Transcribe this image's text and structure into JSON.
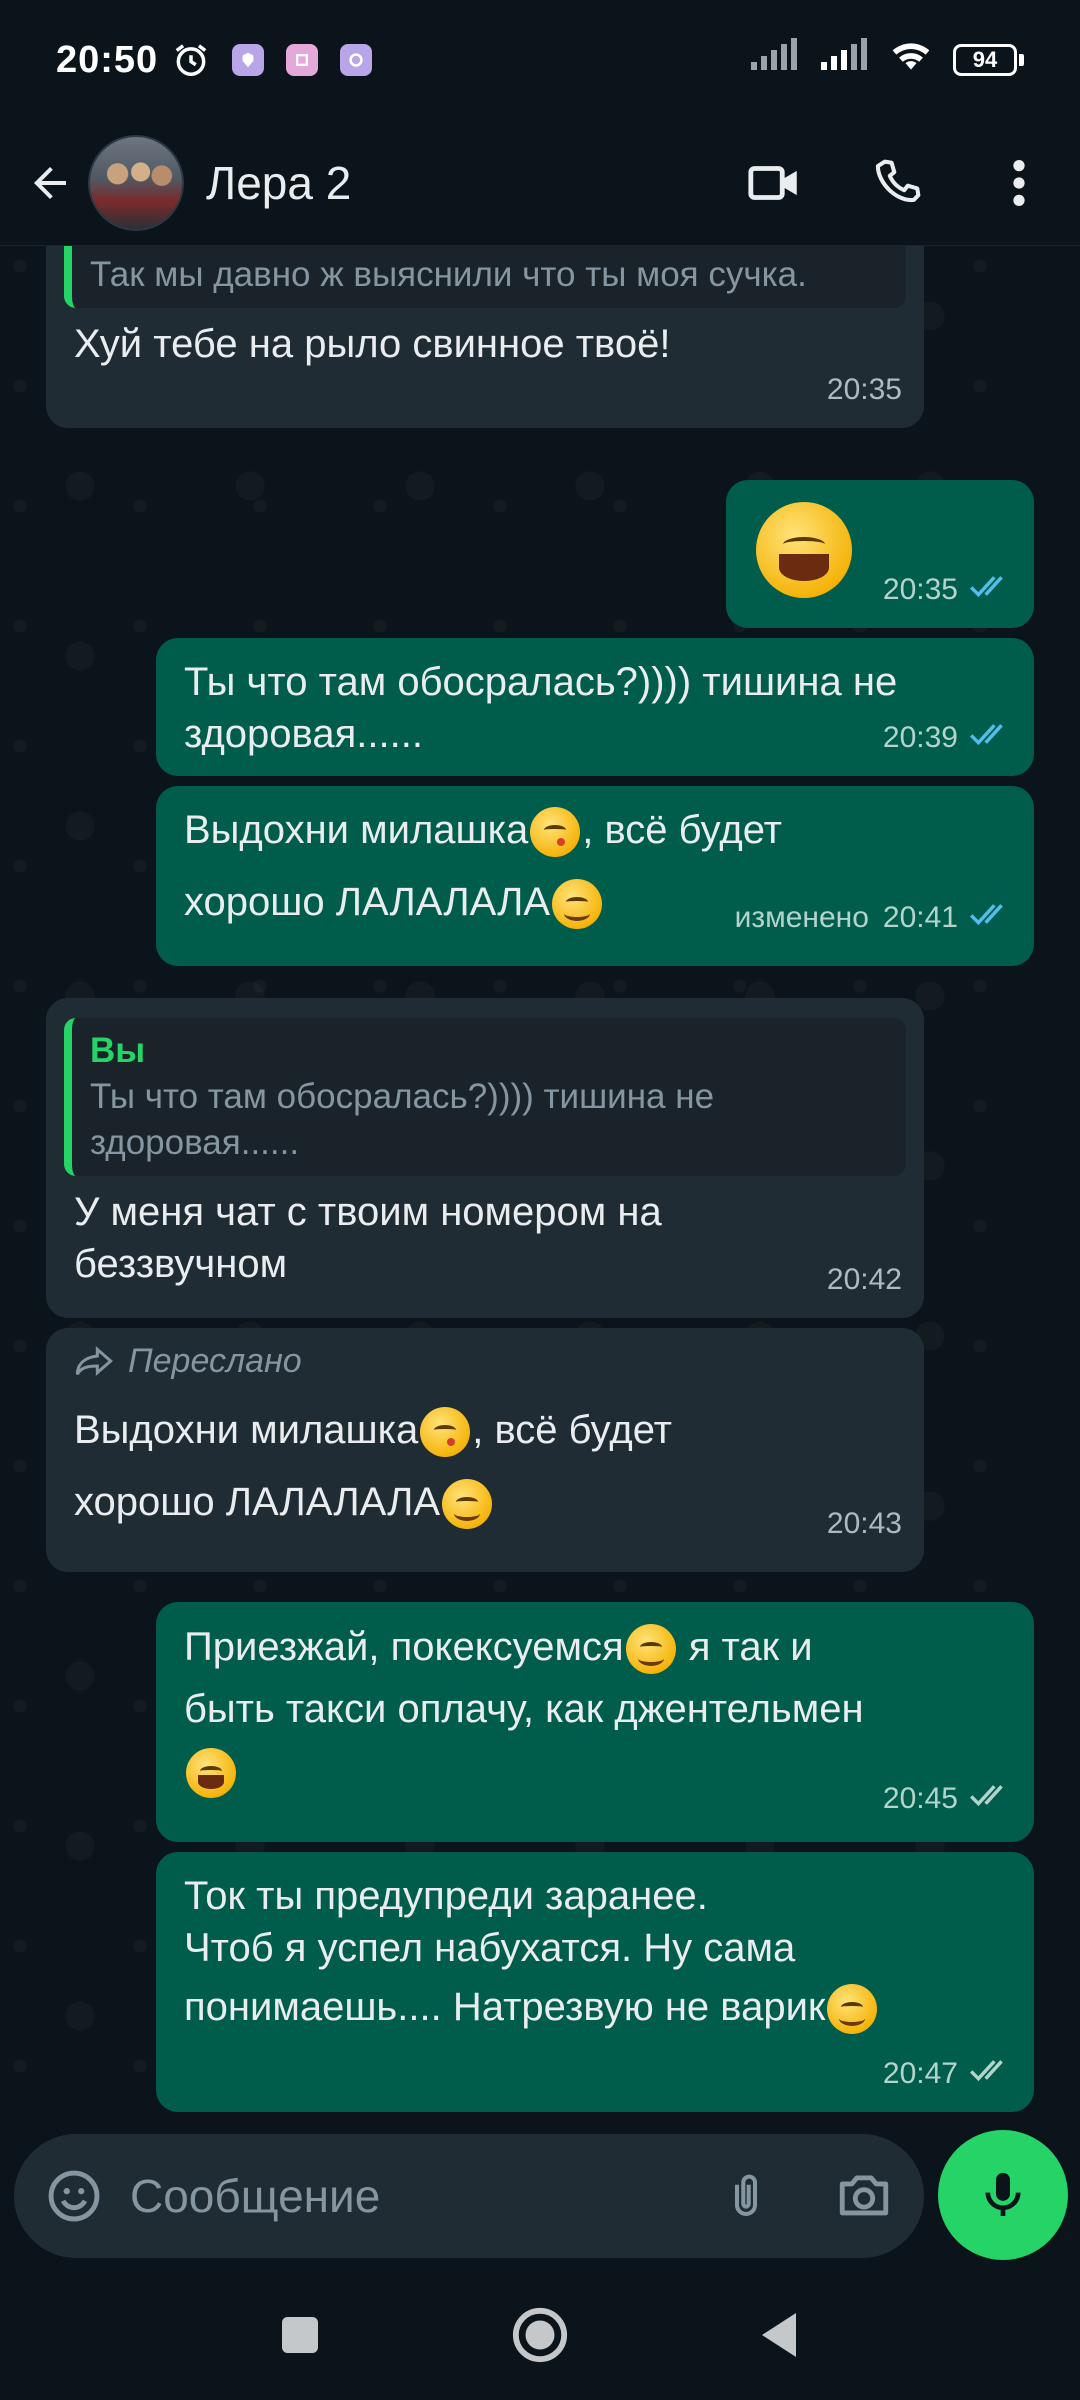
{
  "status_bar": {
    "time": "20:50",
    "battery": "94",
    "icons": [
      "alarm-icon",
      "app-notification-icon",
      "app-notification-icon",
      "app-notification-icon",
      "signal-icon",
      "signal-icon",
      "wifi-icon",
      "battery-icon"
    ]
  },
  "header": {
    "contact_name": "Лера 2",
    "icons": [
      "back-arrow-icon",
      "video-call-icon",
      "voice-call-icon",
      "more-options-icon"
    ]
  },
  "messages": [
    {
      "direction": "incoming",
      "quote_text": "Так мы давно ж выяснили что ты моя сучка.",
      "text": "Хуй тебе на рыло свинное твоё!",
      "time": "20:35"
    },
    {
      "direction": "outgoing",
      "emoji": "face-with-tears-of-joy",
      "time": "20:35",
      "status": "read"
    },
    {
      "direction": "outgoing",
      "text_lines": [
        "Ты что там обосралась?)))) тишина не",
        "здоровая......"
      ],
      "time": "20:39",
      "status": "read"
    },
    {
      "direction": "outgoing",
      "text_a": "Выдохни милашка",
      "text_b": ", всё будет",
      "text_c": "хорошо ЛАЛАЛАЛА",
      "edited_label": "изменено",
      "time": "20:41",
      "status": "read"
    },
    {
      "direction": "incoming",
      "quote_author": "Вы",
      "quote_lines": [
        "Ты что там обосралась?)))) тишина не",
        "здоровая......"
      ],
      "text_lines": [
        "У меня чат с твоим номером на",
        "беззвучном"
      ],
      "time": "20:42"
    },
    {
      "direction": "incoming",
      "forwarded_label": "Переслано",
      "text_a": "Выдохни милашка",
      "text_b": ", всё будет",
      "text_c": "хорошо ЛАЛАЛАЛА",
      "time": "20:43"
    },
    {
      "direction": "outgoing",
      "text_a": "Приезжай, покексуемся",
      "text_b": " я так и",
      "text_c": "быть такси оплачу, как джентельмен",
      "time": "20:45",
      "status": "delivered"
    },
    {
      "direction": "outgoing",
      "text_lines": [
        "Ток ты предупреди заранее.",
        "Чтоб я успел набухатся. Ну сама",
        "понимаешь.... Натрезвую не варик"
      ],
      "time": "20:47",
      "status": "delivered"
    }
  ],
  "input": {
    "placeholder": "Сообщение",
    "icons": [
      "emoji-icon",
      "attach-icon",
      "camera-icon",
      "mic-icon"
    ]
  },
  "colors": {
    "background": "#0b141a",
    "incoming_bubble": "#202c33",
    "outgoing_bubble": "#005c4b",
    "accent": "#25d366",
    "read_ticks": "#53bdeb"
  }
}
